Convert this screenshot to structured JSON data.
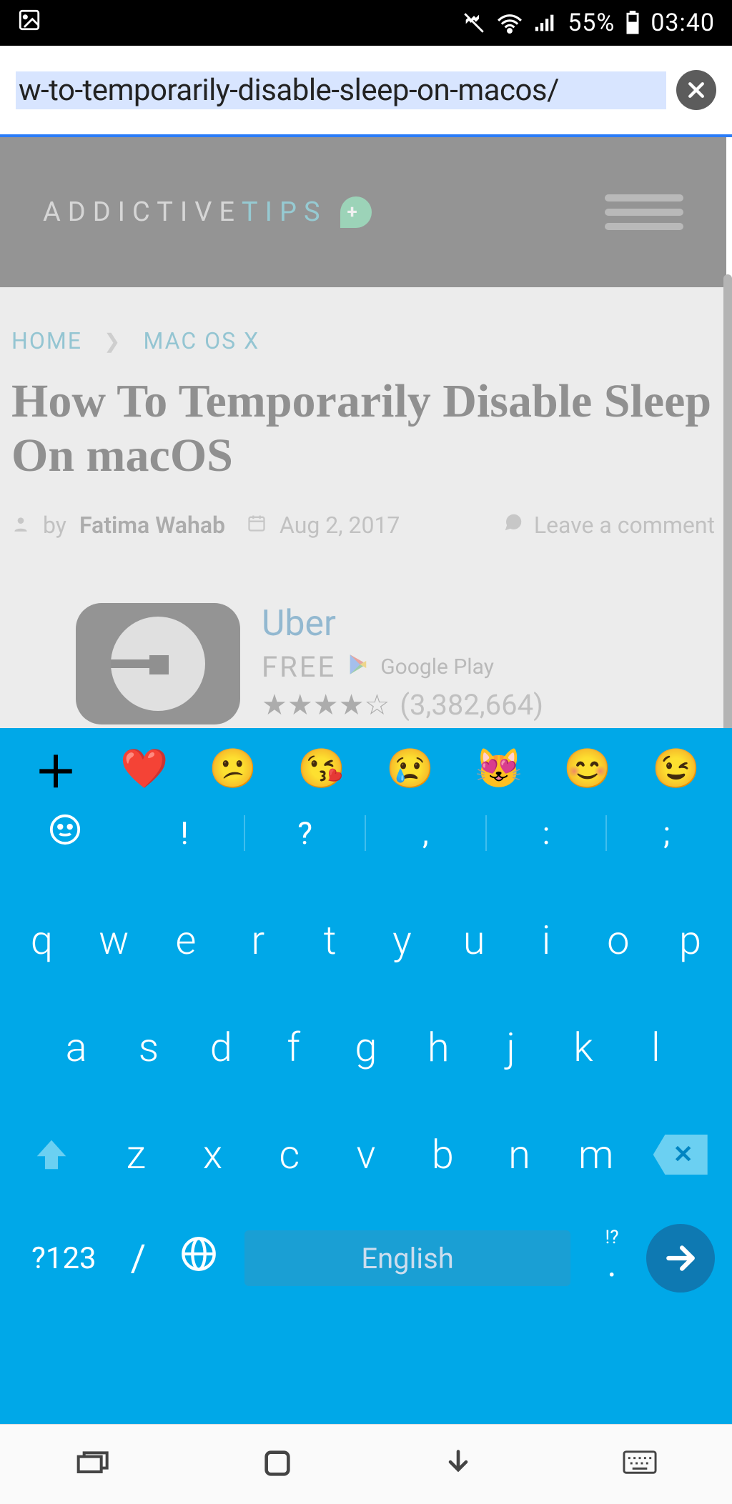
{
  "status": {
    "battery_percent": "55%",
    "time": "03:40"
  },
  "browser": {
    "url_display": "w-to-temporarily-disable-sleep-on-macos/"
  },
  "site": {
    "logo_part1": "ADDICTIVE",
    "logo_part2": "TIPS",
    "logo_badge": "+"
  },
  "breadcrumb": {
    "home": "HOME",
    "category": "MAC OS X"
  },
  "article": {
    "title": "How To Temporarily Disable Sleep On macOS",
    "by_label": "by",
    "author": "Fatima Wahab",
    "date": "Aug 2, 2017",
    "comment_label": "Leave a comment"
  },
  "ad": {
    "name": "Uber",
    "price": "FREE",
    "store": "Google Play",
    "stars": "★★★★☆",
    "rating_count": "(3,382,664)"
  },
  "keyboard": {
    "emoji_icons": [
      "plus",
      "heart",
      "confused",
      "kiss",
      "cry",
      "hearteyes-cat",
      "smile",
      "wink"
    ],
    "punct": [
      "!",
      "?",
      ",",
      ":",
      ";"
    ],
    "row1": [
      "q",
      "w",
      "e",
      "r",
      "t",
      "y",
      "u",
      "i",
      "o",
      "p"
    ],
    "row2": [
      "a",
      "s",
      "d",
      "f",
      "g",
      "h",
      "j",
      "k",
      "l"
    ],
    "row3": [
      "z",
      "x",
      "c",
      "v",
      "b",
      "n",
      "m"
    ],
    "mode_label": "?123",
    "slash": "/",
    "space_label": "English",
    "sym_sup": "!?",
    "sym_sub": "."
  }
}
